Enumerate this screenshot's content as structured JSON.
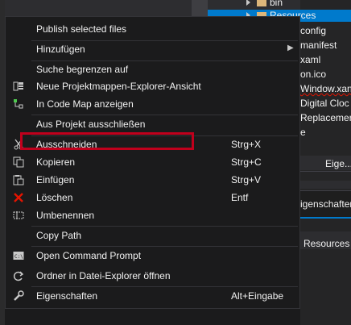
{
  "explorer": {
    "tree": [
      {
        "label": "bin",
        "kind": "folder"
      },
      {
        "label": "Resources",
        "kind": "folder",
        "selected": true
      }
    ],
    "files": [
      "config",
      "manifest",
      "xaml",
      "on.ico",
      "Window.xan",
      "Digital Cloc",
      "Replacemer",
      "e"
    ],
    "tab_label": "Eige...",
    "props_title": "igenschaften",
    "props_resource": "Resources"
  },
  "colors": {
    "accent": "#007acc",
    "highlight_box": "#c0001c",
    "delete_icon": "#e51400",
    "folder": "#dcb67a"
  },
  "menu": {
    "items": [
      {
        "label": "Publish selected files",
        "icon": ""
      },
      {
        "label": "Hinzufügen",
        "icon": "",
        "submenu": true
      },
      {
        "label": "Suche begrenzen auf",
        "icon": ""
      },
      {
        "label": "Neue Projektmappen-Explorer-Ansicht",
        "icon": "new-view-icon"
      },
      {
        "label": "In Code Map anzeigen",
        "icon": "code-map-icon"
      },
      {
        "label": "Aus Projekt ausschließen",
        "icon": "",
        "highlighted": true
      },
      {
        "label": "Ausschneiden",
        "icon": "cut-icon",
        "shortcut": "Strg+X"
      },
      {
        "label": "Kopieren",
        "icon": "copy-icon",
        "shortcut": "Strg+C"
      },
      {
        "label": "Einfügen",
        "icon": "paste-icon",
        "shortcut": "Strg+V"
      },
      {
        "label": "Löschen",
        "icon": "delete-icon",
        "shortcut": "Entf"
      },
      {
        "label": "Umbenennen",
        "icon": "rename-icon"
      },
      {
        "label": "Copy Path",
        "icon": ""
      },
      {
        "label": "Open Command Prompt",
        "icon": "command-prompt-icon"
      },
      {
        "label": "Ordner in Datei-Explorer öffnen",
        "icon": "open-folder-icon"
      },
      {
        "label": "Eigenschaften",
        "icon": "wrench-icon",
        "shortcut": "Alt+Eingabe"
      }
    ]
  }
}
